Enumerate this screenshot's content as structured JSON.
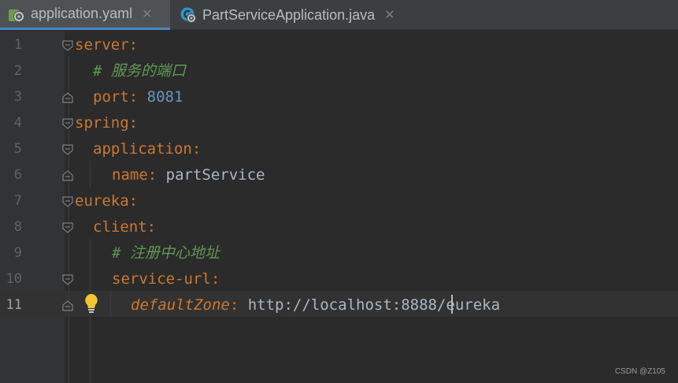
{
  "tabs": [
    {
      "label": "application.yaml",
      "icon": "spring-yaml-icon",
      "active": true
    },
    {
      "label": "PartServiceApplication.java",
      "icon": "spring-java-class-icon",
      "active": false
    }
  ],
  "close_glyph": "✕",
  "lines": [
    {
      "number": "1",
      "parts": [
        {
          "t": "server",
          "c": "key"
        },
        {
          "t": ":",
          "c": "punct"
        }
      ]
    },
    {
      "number": "2",
      "parts": [
        {
          "t": "# 服务的端口",
          "c": "comment"
        }
      ]
    },
    {
      "number": "3",
      "parts": [
        {
          "t": "port",
          "c": "key"
        },
        {
          "t": ": ",
          "c": "punct"
        },
        {
          "t": "8081",
          "c": "number"
        }
      ]
    },
    {
      "number": "4",
      "parts": [
        {
          "t": "spring",
          "c": "key"
        },
        {
          "t": ":",
          "c": "punct"
        }
      ]
    },
    {
      "number": "5",
      "parts": [
        {
          "t": "application",
          "c": "key"
        },
        {
          "t": ":",
          "c": "punct"
        }
      ]
    },
    {
      "number": "6",
      "parts": [
        {
          "t": "name",
          "c": "key"
        },
        {
          "t": ": ",
          "c": "punct"
        },
        {
          "t": "partService",
          "c": "value"
        }
      ]
    },
    {
      "number": "7",
      "parts": [
        {
          "t": "eureka",
          "c": "key"
        },
        {
          "t": ":",
          "c": "punct"
        }
      ]
    },
    {
      "number": "8",
      "parts": [
        {
          "t": "client",
          "c": "key"
        },
        {
          "t": ":",
          "c": "punct"
        }
      ]
    },
    {
      "number": "9",
      "parts": [
        {
          "t": "# 注册中心地址",
          "c": "comment"
        }
      ]
    },
    {
      "number": "10",
      "parts": [
        {
          "t": "service-url",
          "c": "key"
        },
        {
          "t": ":",
          "c": "punct"
        }
      ]
    },
    {
      "number": "11",
      "parts": [
        {
          "t": "defaultZone",
          "c": "italic-key"
        },
        {
          "t": ": ",
          "c": "punct"
        },
        {
          "t": "http://localhost:8888/eureka",
          "c": "value"
        }
      ]
    }
  ],
  "watermark": "CSDN @Z105",
  "colors": {
    "key": "#cc7832",
    "comment": "#629755",
    "number": "#6897bb",
    "text": "#a9b7c6",
    "active_tab_underline": "#4a88c7",
    "background": "#2b2b2b"
  }
}
